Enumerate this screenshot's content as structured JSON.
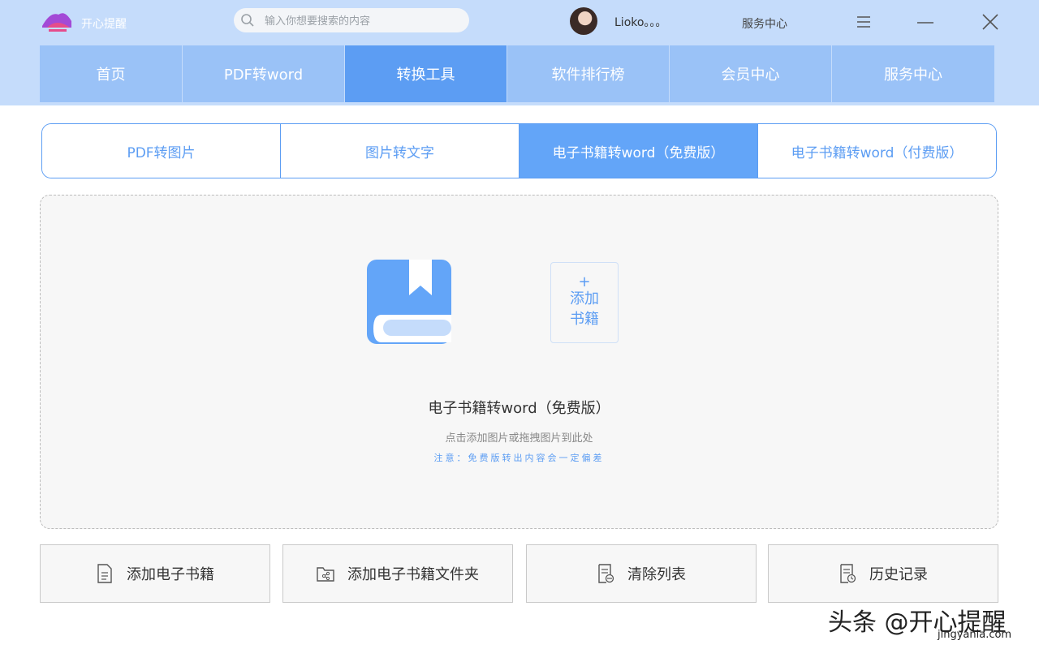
{
  "header": {
    "app_name": "开心提醒",
    "search_placeholder": "输入你想要搜索的内容",
    "user_name": "Lioko。。。",
    "service_center": "服务中心"
  },
  "nav": {
    "items": [
      "首页",
      "PDF转word",
      "转换工具",
      "软件排行榜",
      "会员中心",
      "服务中心"
    ],
    "active": "转换工具"
  },
  "subtabs": {
    "items": [
      "PDF转图片",
      "图片转文字",
      "电子书籍转word（免费版）",
      "电子书籍转word（付费版）"
    ],
    "active": "电子书籍转word（免费版）"
  },
  "dropzone": {
    "add_plus": "+",
    "add_line1": "添加",
    "add_line2": "书籍",
    "title": "电子书籍转word（免费版）",
    "hint": "点击添加图片或拖拽图片到此处",
    "note": "注意：免费版转出内容会一定偏差"
  },
  "actions": {
    "add_ebook": "添加电子书籍",
    "add_folder": "添加电子书籍文件夹",
    "clear_list": "清除列表",
    "history": "历史记录"
  },
  "watermark": {
    "main": "头条 @开心提醒",
    "sub": "jingyanla.com"
  },
  "colors": {
    "accent": "#5c9df3",
    "header_bg": "#c5dcfb",
    "nav_bg": "#9ac2f7"
  }
}
